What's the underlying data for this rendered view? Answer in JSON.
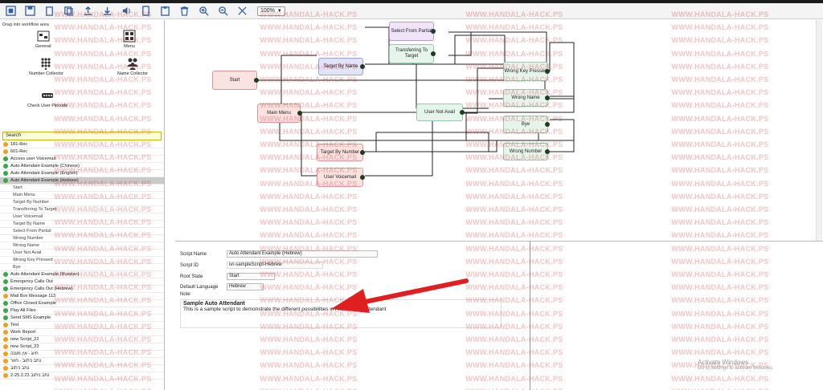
{
  "toolbar": {
    "zoom": "100%",
    "icons": [
      "new-icon",
      "save-icon",
      "delete-icon",
      "copy-icon",
      "upload-icon",
      "download-icon",
      "voice-icon",
      "duplicate-icon",
      "paste-icon",
      "trash-icon",
      "zoom-in-icon",
      "zoom-out-icon",
      "fit-icon"
    ]
  },
  "palette": {
    "drag_label": "Drag into workflow area",
    "tools": {
      "general": "General",
      "menu": "Menu",
      "number_collector": "Number Collector",
      "name_collector": "Name Collector",
      "check_user_pincode": "Check User Pincode"
    }
  },
  "list": {
    "search_placeholder": "Search",
    "items": [
      {
        "label": "181-Rec",
        "status": "orange"
      },
      {
        "label": "601-Rec",
        "status": "orange"
      },
      {
        "label": "Access user Voicemail",
        "status": "green"
      },
      {
        "label": "Auto Attendant Example (Chinese)",
        "status": "green"
      },
      {
        "label": "Auto Attendant Example (English)",
        "status": "green"
      },
      {
        "label": "Auto Attendant Example (Hebrew)",
        "status": "green"
      },
      {
        "label": "Start",
        "status": "child"
      },
      {
        "label": "Main Menu",
        "status": "child"
      },
      {
        "label": "Target By Number",
        "status": "child"
      },
      {
        "label": "Transferring To Target",
        "status": "child"
      },
      {
        "label": "User Voicemail",
        "status": "child"
      },
      {
        "label": "Target By Name",
        "status": "child"
      },
      {
        "label": "Select From Partial",
        "status": "child"
      },
      {
        "label": "Wrong Number",
        "status": "child"
      },
      {
        "label": "Wrong Name",
        "status": "child"
      },
      {
        "label": "User Not Avail",
        "status": "child"
      },
      {
        "label": "Wrong Key Pressed",
        "status": "child"
      },
      {
        "label": "Bye",
        "status": "child"
      },
      {
        "label": "Auto Attendant Example (Russian)",
        "status": "green"
      },
      {
        "label": "Emergency Calls Out",
        "status": "green"
      },
      {
        "label": "Emergency Calls Out (Hebrew)",
        "status": "green"
      },
      {
        "label": "Mail Box Message 113",
        "status": "orange"
      },
      {
        "label": "Office Closed Example",
        "status": "green"
      },
      {
        "label": "Play All Files",
        "status": "green"
      },
      {
        "label": "Send SMS Example",
        "status": "green"
      },
      {
        "label": "Test",
        "status": "orange"
      },
      {
        "label": "Work Report",
        "status": "orange"
      },
      {
        "label": "new Script_22",
        "status": "orange"
      },
      {
        "label": "new Script_23",
        "status": "orange"
      },
      {
        "label": "חיוג - אין מענה",
        "status": "orange"
      },
      {
        "label": "נתב ניתוב - חוזר",
        "status": "orange"
      },
      {
        "label": "נתב ניתוב",
        "status": "orange"
      },
      {
        "label": "נתב ניתוב 2-25.2.23",
        "status": "orange"
      }
    ]
  },
  "workflow": {
    "nodes": {
      "start": "Start",
      "main_menu": "Main Menu",
      "target_by_name": "Target By Name",
      "select_from_partial": "Select From Partial",
      "transferring_to_target": "Transferring To Target",
      "user_not_avail": "User Not Avail",
      "target_by_number": "Target By Number",
      "user_voicemail": "User Voicemail",
      "wrong_key_pressed": "Wrong Key Pressed",
      "wrong_name": "Wrong Name",
      "bye": "Bye",
      "wrong_number": "Wrong Number"
    }
  },
  "properties": {
    "script_name_label": "Script Name",
    "script_name_value": "Auto Attendant Example (Hebrew)",
    "script_id_label": "Script ID",
    "script_id_value": "ivr-sampleScript-Hebrew",
    "root_state_label": "Root State",
    "root_state_value": "Start",
    "default_language_label": "Default Language",
    "default_language_value": "Hebrew",
    "note_label": "Note",
    "note_title": "Sample Auto Attendant",
    "note_body": "This is a sample script to demonstrate the different possibilities in Axonix Auto Attendant"
  },
  "watermark": "WWW.HANDALA-HACK.PS",
  "windows": {
    "activate_title": "Activate Windows",
    "activate_sub": "Go to Settings to activate Windows."
  },
  "colors": {
    "watermark": "#dc2828",
    "arrow": "#e02020",
    "accent": "#2f5fa8"
  }
}
